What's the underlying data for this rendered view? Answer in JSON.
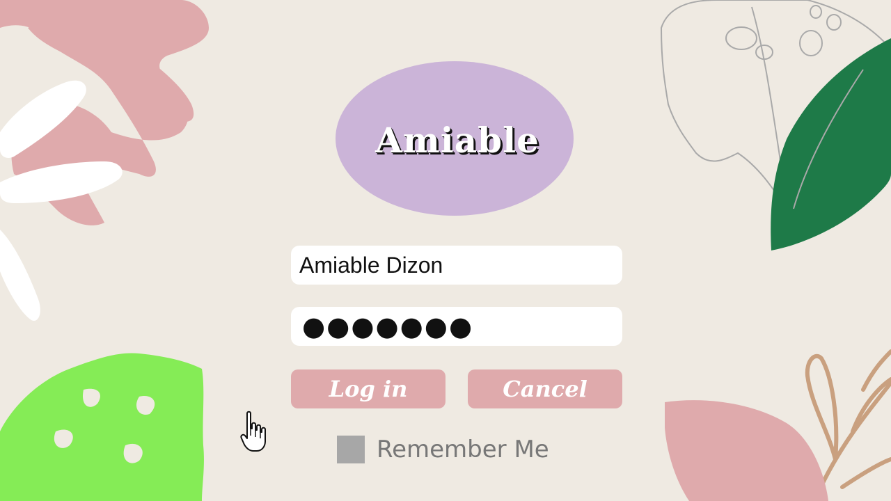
{
  "logo": {
    "text": "Amiable",
    "color": "#cbb4d8"
  },
  "form": {
    "username_value": "Amiable Dizon",
    "password_mask": "●●●●●●●"
  },
  "buttons": {
    "login_label": "Log in",
    "cancel_label": "Cancel",
    "color": "#dfaaac"
  },
  "remember": {
    "label": "Remember Me",
    "checked": false
  },
  "cursor": {
    "icon": "hand-pointer-icon"
  },
  "background": {
    "color": "#efeae2",
    "accents": [
      "#dfaaac",
      "#ffffff",
      "#85ec56",
      "#1e7a48",
      "#c9a07f",
      "#a9a9a9"
    ]
  }
}
